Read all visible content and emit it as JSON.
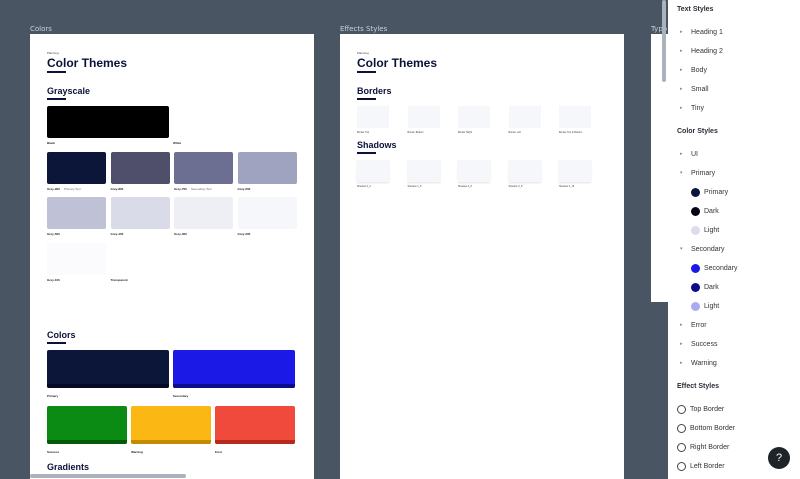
{
  "canvas": {
    "labels": {
      "colors": "Colors",
      "effects": "Effects Styles",
      "type": "Typo"
    }
  },
  "colors_frame": {
    "eyebrow": "Planning",
    "title": "Color Themes",
    "grayscale": {
      "title": "Grayscale",
      "black": {
        "label": "Black",
        "color": "#000000"
      },
      "white": {
        "label": "White",
        "color": "#ffffff"
      },
      "row1": [
        {
          "label": "Grey-900",
          "sub": "Primary Text",
          "color": "#0b1638"
        },
        {
          "label": "Grey-800",
          "sub": "",
          "color": "#4f4f6c"
        },
        {
          "label": "Grey-700",
          "sub": "Secondary Text",
          "color": "#6d6f92"
        },
        {
          "label": "Grey-600",
          "sub": "",
          "color": "#9fa3c0"
        }
      ],
      "row2": [
        {
          "label": "Grey-500",
          "sub": "",
          "color": "#bfc1d6"
        },
        {
          "label": "Grey-400",
          "sub": "",
          "color": "#dadbe8"
        },
        {
          "label": "Grey-300",
          "sub": "",
          "color": "#eeeff5"
        },
        {
          "label": "Grey-200",
          "sub": "",
          "color": "#f6f7fb"
        }
      ],
      "row3": [
        {
          "label": "Grey-100",
          "sub": "",
          "color": "#fbfbfd"
        },
        {
          "label": "Transparent",
          "sub": "",
          "color": "#ffffff"
        }
      ]
    },
    "colors": {
      "title": "Colors",
      "primary": {
        "label": "Primary",
        "color": "#0b1638",
        "strip": "#050a24"
      },
      "secondary": {
        "label": "Secondary",
        "color": "#1a19e6",
        "strip": "#0d0c8a"
      },
      "success": {
        "label": "Success",
        "color": "#0b8a14",
        "strip": "#055a0a"
      },
      "warning": {
        "label": "Warning",
        "color": "#fbb713",
        "strip": "#c48a00"
      },
      "error": {
        "label": "Error",
        "color": "#ef4a3b",
        "strip": "#b8281c"
      }
    },
    "gradients": {
      "title": "Gradients"
    }
  },
  "effects_frame": {
    "eyebrow": "Planning",
    "title": "Color Themes",
    "borders": {
      "title": "Borders",
      "items": [
        "Border Top",
        "Border Bottom",
        "Border Right",
        "Border Left",
        "Border Top & Bottom"
      ]
    },
    "shadows": {
      "title": "Shadows",
      "items": [
        "Shadow 0_2",
        "Shadow 1_6",
        "Shadow 2_8",
        "Shadow 3_8",
        "Shadow 4_16"
      ]
    }
  },
  "panel": {
    "text_styles": {
      "heading": "Text Styles",
      "items": [
        "Heading 1",
        "Heading 2",
        "Body",
        "Small",
        "Tiny"
      ]
    },
    "color_styles": {
      "heading": "Color Styles",
      "ui": "UI",
      "primary": {
        "label": "Primary",
        "children": [
          {
            "label": "Primary",
            "color": "#0b1638"
          },
          {
            "label": "Dark",
            "color": "#050814"
          },
          {
            "label": "Light",
            "color": "#dcdcea"
          }
        ]
      },
      "secondary": {
        "label": "Secondary",
        "children": [
          {
            "label": "Secondary",
            "color": "#1a19e6"
          },
          {
            "label": "Dark",
            "color": "#0d0c8a"
          },
          {
            "label": "Light",
            "color": "#a9aaf0"
          }
        ]
      },
      "error": "Error",
      "success": "Success",
      "warning": "Warning"
    },
    "effect_styles": {
      "heading": "Effect Styles",
      "items": [
        "Top Border",
        "Bottom Border",
        "Right Border",
        "Left Border"
      ]
    }
  },
  "help": {
    "label": "?"
  }
}
